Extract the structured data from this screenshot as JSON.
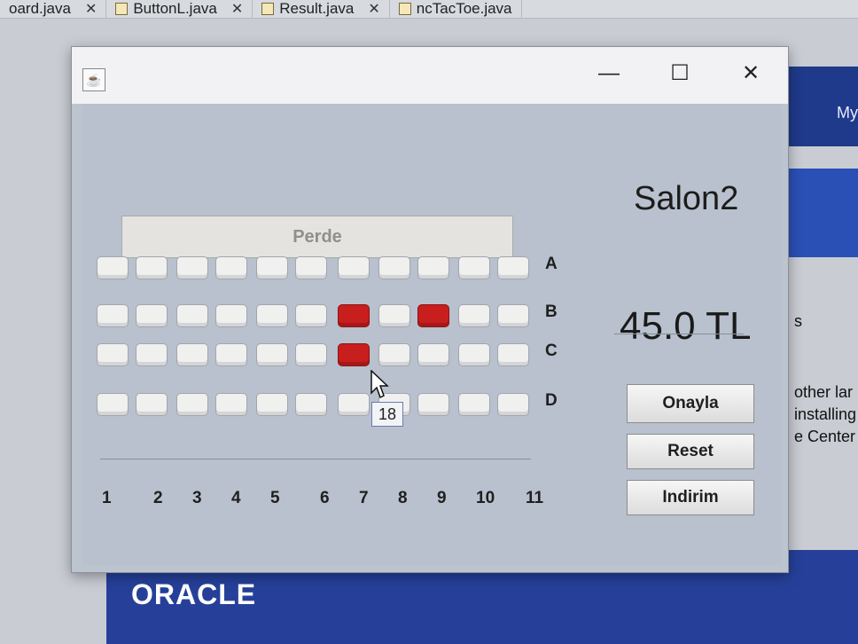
{
  "ide": {
    "tabs": [
      {
        "label": "oard.java"
      },
      {
        "label": "ButtonL.java"
      },
      {
        "label": "Result.java"
      },
      {
        "label": "ncTacToe.java"
      }
    ]
  },
  "background": {
    "top_right_text": "My",
    "side_texts": [
      "s",
      "other lar",
      "installing",
      "e Center"
    ],
    "logo_text": "ORACLE"
  },
  "window": {
    "title_icon": "java-coffee-icon",
    "controls": {
      "minimize": "—",
      "maximize": "☐",
      "close": "✕"
    }
  },
  "cinema": {
    "hall_title": "Salon2",
    "screen_label": "Perde",
    "price": "45.0 TL",
    "rows": [
      {
        "label": "A",
        "taken": []
      },
      {
        "label": "B",
        "taken": [
          7,
          9
        ]
      },
      {
        "label": "C",
        "taken": [
          7
        ]
      },
      {
        "label": "D",
        "taken": []
      }
    ],
    "columns": [
      "1",
      "2",
      "3",
      "4",
      "5",
      "6",
      "7",
      "8",
      "9",
      "10",
      "11"
    ],
    "tooltip": "18",
    "buttons": {
      "confirm": "Onayla",
      "reset": "Reset",
      "discount": "Indirim"
    },
    "colors": {
      "taken": "#c81e1e",
      "free": "#f0f0ef"
    }
  }
}
